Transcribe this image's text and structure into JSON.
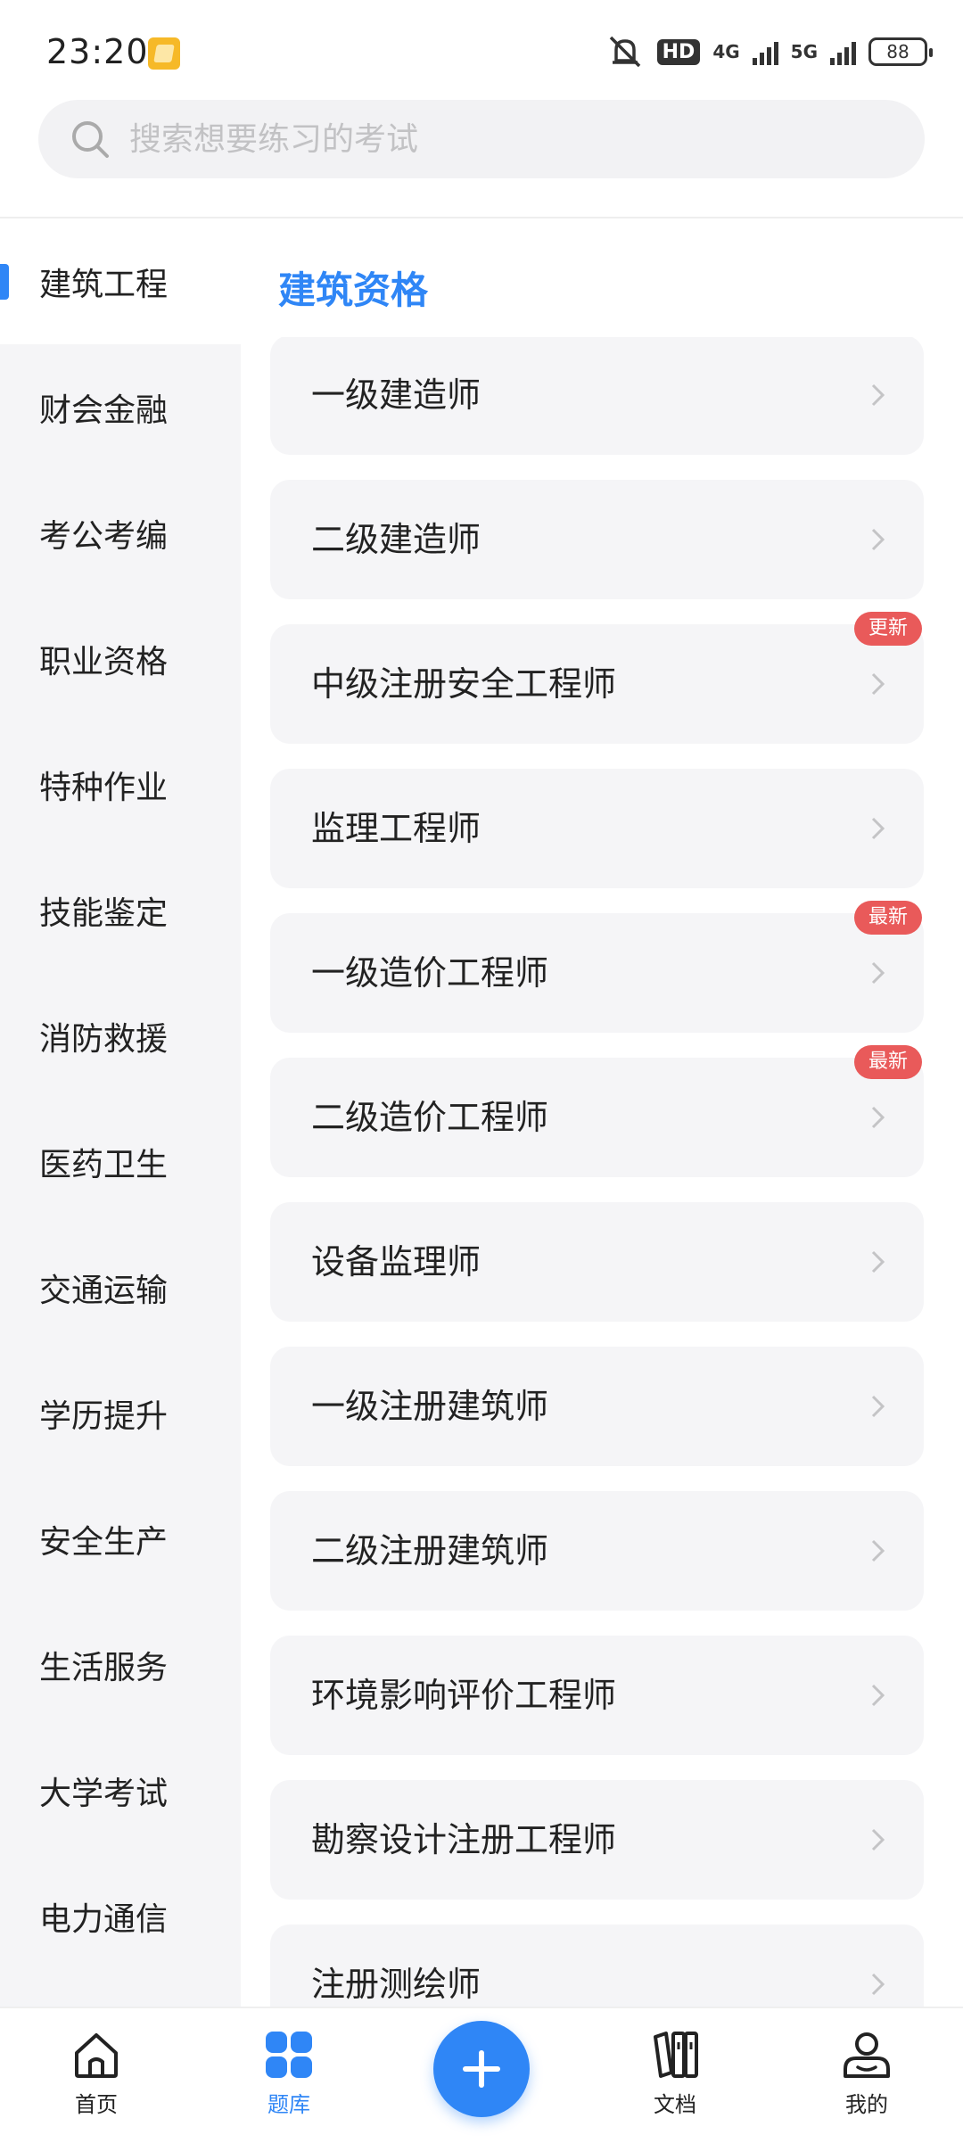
{
  "status_bar": {
    "time": "23:20",
    "hd_badge": "HD",
    "network1": "4G",
    "network2": "5G",
    "battery": "88"
  },
  "search": {
    "placeholder": "搜索想要练习的考试"
  },
  "sidebar": {
    "items": [
      {
        "label": "建筑工程",
        "active": true
      },
      {
        "label": "财会金融"
      },
      {
        "label": "考公考编"
      },
      {
        "label": "职业资格"
      },
      {
        "label": "特种作业"
      },
      {
        "label": "技能鉴定"
      },
      {
        "label": "消防救援"
      },
      {
        "label": "医药卫生"
      },
      {
        "label": "交通运输"
      },
      {
        "label": "学历提升"
      },
      {
        "label": "安全生产"
      },
      {
        "label": "生活服务"
      },
      {
        "label": "大学考试"
      },
      {
        "label": "电力通信"
      }
    ]
  },
  "content": {
    "section_title": "建筑资格",
    "items": [
      {
        "label": "一级建造师"
      },
      {
        "label": "二级建造师"
      },
      {
        "label": "中级注册安全工程师",
        "badge": "更新"
      },
      {
        "label": "监理工程师"
      },
      {
        "label": "一级造价工程师",
        "badge": "最新"
      },
      {
        "label": "二级造价工程师",
        "badge": "最新"
      },
      {
        "label": "设备监理师"
      },
      {
        "label": "一级注册建筑师"
      },
      {
        "label": "二级注册建筑师"
      },
      {
        "label": "环境影响评价工程师"
      },
      {
        "label": "勘察设计注册工程师"
      },
      {
        "label": "注册测绘师"
      }
    ]
  },
  "bottom_nav": {
    "home": "首页",
    "bank": "题库",
    "docs": "文档",
    "mine": "我的"
  },
  "colors": {
    "accent": "#2f86f6",
    "badge": "#e95a5a"
  }
}
